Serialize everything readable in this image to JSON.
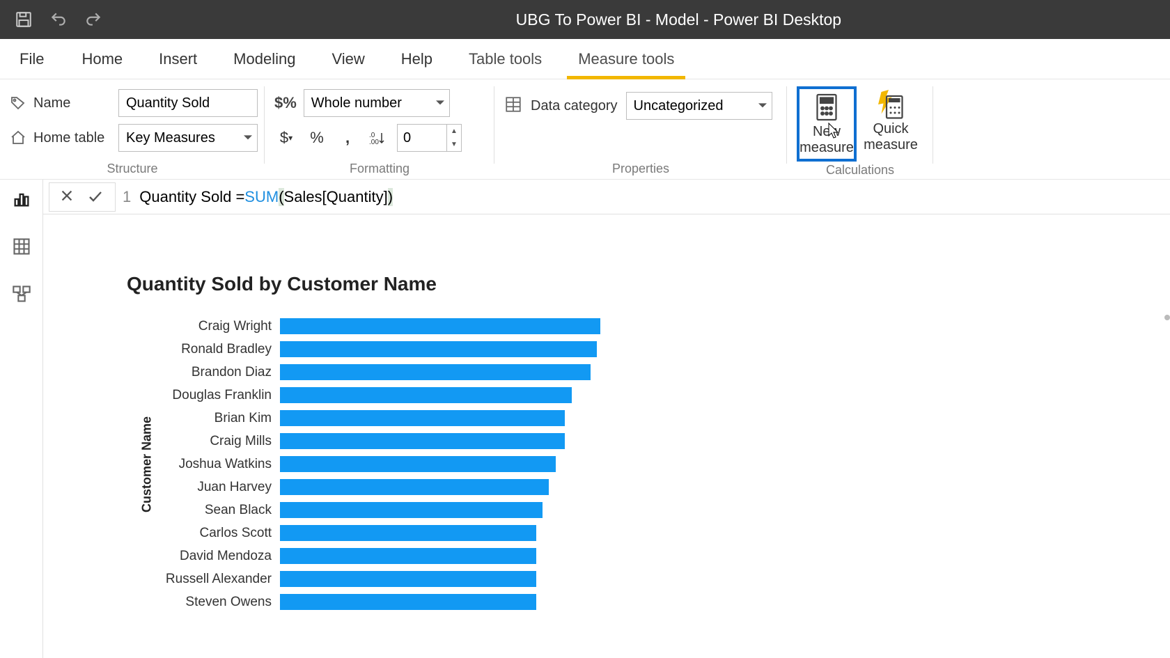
{
  "title": "UBG To Power BI - Model - Power BI Desktop",
  "tabs": {
    "file": "File",
    "home": "Home",
    "insert": "Insert",
    "modeling": "Modeling",
    "view": "View",
    "help": "Help",
    "table_tools": "Table tools",
    "measure_tools": "Measure tools"
  },
  "ribbon": {
    "structure": {
      "label": "Structure",
      "name_label": "Name",
      "name_value": "Quantity Sold",
      "home_table_label": "Home table",
      "home_table_value": "Key Measures"
    },
    "formatting": {
      "label": "Formatting",
      "format_value": "Whole number",
      "decimals_value": "0"
    },
    "properties": {
      "label": "Properties",
      "category_label": "Data category",
      "category_value": "Uncategorized"
    },
    "calculations": {
      "label": "Calculations",
      "new_measure_l1": "New",
      "new_measure_l2": "measure",
      "quick_measure_l1": "Quick",
      "quick_measure_l2": "measure"
    }
  },
  "formula": {
    "line": "1",
    "pre": "Quantity Sold = ",
    "fn": "SUM",
    "post_open": "(",
    "arg": " Sales[Quantity] ",
    "post_close": ")"
  },
  "chart_data": {
    "type": "bar",
    "title": "Quantity Sold by Customer Name",
    "ylabel": "Customer Name",
    "xlabel": "",
    "categories": [
      "Craig Wright",
      "Ronald Bradley",
      "Brandon Diaz",
      "Douglas Franklin",
      "Brian Kim",
      "Craig Mills",
      "Joshua Watkins",
      "Juan Harvey",
      "Sean Black",
      "Carlos Scott",
      "David Mendoza",
      "Russell Alexander",
      "Steven Owens"
    ],
    "values": [
      100,
      99,
      97,
      91,
      89,
      89,
      86,
      84,
      82,
      80,
      80,
      80,
      80
    ],
    "xlim": [
      0,
      100
    ]
  }
}
